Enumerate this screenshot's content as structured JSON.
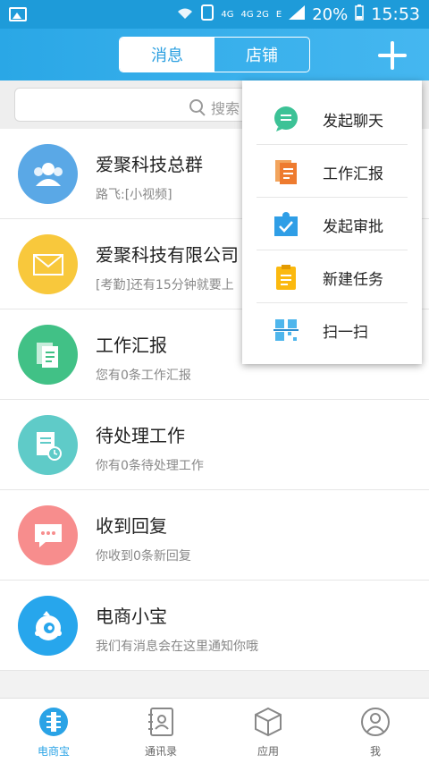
{
  "statusbar": {
    "network": "4G",
    "network_dual": "4G 2G",
    "signal_type": "E",
    "battery": "20%",
    "time": "15:53"
  },
  "header": {
    "tabs": [
      {
        "label": "消息",
        "active": true
      },
      {
        "label": "店铺",
        "active": false
      }
    ],
    "plus_icon": "plus-icon",
    "accent": "#2aa7e6"
  },
  "search": {
    "placeholder": "搜索"
  },
  "list": [
    {
      "title": "爱聚科技总群",
      "sub": "路飞:[小视频]",
      "icon": "group-icon",
      "color": "#5aa8e6"
    },
    {
      "title": "爱聚科技有限公司",
      "sub": "[考勤]还有15分钟就要上",
      "icon": "envelope-icon",
      "color": "#f8c83c"
    },
    {
      "title": "工作汇报",
      "sub": "您有0条工作汇报",
      "icon": "report-icon",
      "color": "#41c186"
    },
    {
      "title": "待处理工作",
      "sub": "你有0条待处理工作",
      "icon": "pending-task-icon",
      "color": "#5fcbc8"
    },
    {
      "title": "收到回复",
      "sub": "你收到0条新回复",
      "icon": "chat-bubble-icon",
      "color": "#f78d8d"
    },
    {
      "title": "电商小宝",
      "sub": "我们有消息会在这里通知你哦",
      "icon": "mascot-icon",
      "color": "#27a6ec"
    }
  ],
  "menu": [
    {
      "label": "发起聊天",
      "icon": "chat-icon"
    },
    {
      "label": "工作汇报",
      "icon": "report-icon"
    },
    {
      "label": "发起审批",
      "icon": "approval-icon"
    },
    {
      "label": "新建任务",
      "icon": "clipboard-icon"
    },
    {
      "label": "扫一扫",
      "icon": "qr-scan-icon"
    }
  ],
  "nav": [
    {
      "label": "电商宝",
      "icon": "home-icon",
      "active": true
    },
    {
      "label": "通讯录",
      "icon": "contacts-icon",
      "active": false
    },
    {
      "label": "应用",
      "icon": "cube-icon",
      "active": false
    },
    {
      "label": "我",
      "icon": "profile-icon",
      "active": false
    }
  ]
}
